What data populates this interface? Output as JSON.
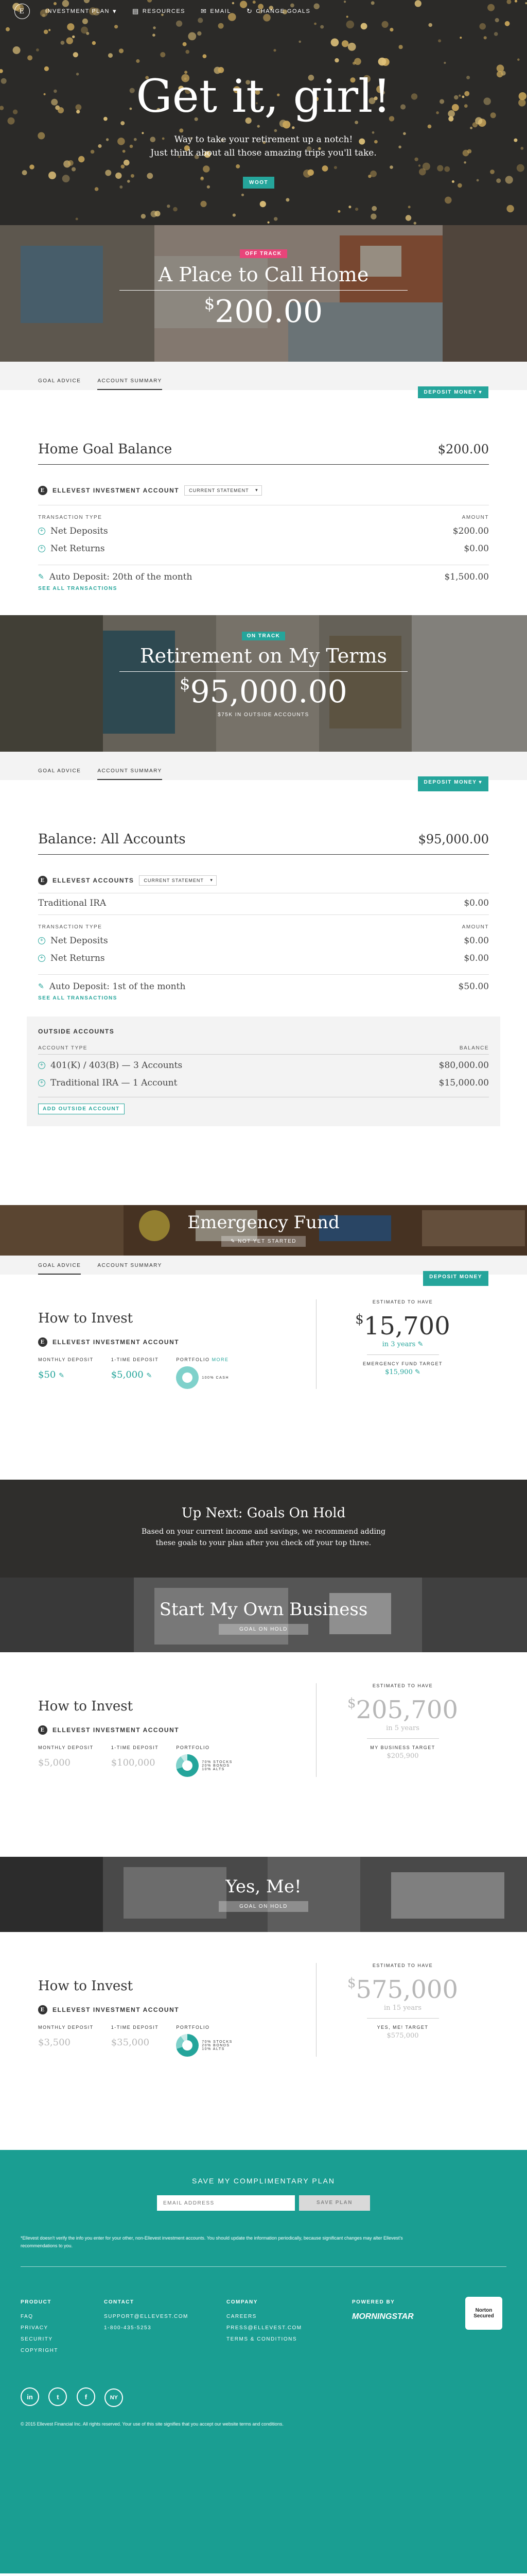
{
  "nav": {
    "logo": "E",
    "items": [
      "INVESTMENT PLAN",
      "RESOURCES",
      "EMAIL",
      "CHANGE GOALS"
    ],
    "item_icons": [
      "chevron-down-icon",
      "book-icon",
      "envelope-icon",
      "refresh-icon"
    ]
  },
  "hero": {
    "title": "Get it, girl!",
    "subtitle_1": "Way to take your retirement up a notch!",
    "subtitle_2": "Just think about all those amazing trips you'll take.",
    "button": "WOOT"
  },
  "home": {
    "badge": "OFF TRACK",
    "title": "A Place to Call Home",
    "amount_symbol": "$",
    "amount": "200.00",
    "tabs": [
      "GOAL ADVICE",
      "ACCOUNT SUMMARY"
    ],
    "deposit_button": "DEPOSIT MONEY",
    "balance_label": "Home Goal Balance",
    "balance_value": "$200.00",
    "account_name": "ELLEVEST INVESTMENT ACCOUNT",
    "statement": "CURRENT STATEMENT",
    "th_left": "TRANSACTION TYPE",
    "th_right": "AMOUNT",
    "rows": [
      {
        "label": "Net Deposits",
        "value": "$200.00"
      },
      {
        "label": "Net Returns",
        "value": "$0.00"
      }
    ],
    "auto_deposit": "Auto Deposit: 20th of the month",
    "auto_value": "$1,500.00",
    "see_all": "SEE ALL TRANSACTIONS"
  },
  "retire": {
    "badge": "ON TRACK",
    "title": "Retirement on My Terms",
    "amount_symbol": "$",
    "amount": "95,000.00",
    "note": "$75K IN OUTSIDE ACCOUNTS",
    "tabs": [
      "GOAL ADVICE",
      "ACCOUNT SUMMARY"
    ],
    "deposit_button": "DEPOSIT MONEY",
    "balance_label": "Balance: All Accounts",
    "balance_value": "$95,000.00",
    "account_name": "ELLEVEST ACCOUNTS",
    "statement": "CURRENT STATEMENT",
    "ira_label": "Traditional IRA",
    "ira_value": "$0.00",
    "th_left": "TRANSACTION TYPE",
    "th_right": "AMOUNT",
    "rows": [
      {
        "label": "Net Deposits",
        "value": "$0.00"
      },
      {
        "label": "Net Returns",
        "value": "$0.00"
      }
    ],
    "auto_deposit": "Auto Deposit: 1st of the month",
    "auto_value": "$50.00",
    "see_all": "SEE ALL TRANSACTIONS",
    "outside_title": "OUTSIDE ACCOUNTS",
    "outside_th_left": "ACCOUNT TYPE",
    "outside_th_right": "BALANCE",
    "outside_rows": [
      {
        "label": "401(K) / 403(B) — 3 Accounts",
        "value": "$80,000.00"
      },
      {
        "label": "Traditional IRA — 1 Account",
        "value": "$15,000.00"
      }
    ],
    "add_outside": "ADD OUTSIDE ACCOUNT"
  },
  "emergency": {
    "title": "Emergency Fund",
    "button": "NOT YET STARTED",
    "tabs": [
      "GOAL ADVICE",
      "ACCOUNT SUMMARY"
    ],
    "deposit_button": "DEPOSIT MONEY",
    "how": "How to Invest",
    "account_name": "ELLEVEST INVESTMENT ACCOUNT",
    "monthly_label": "MONTHLY DEPOSIT",
    "monthly_value": "$50",
    "onetime_label": "1-TIME DEPOSIT",
    "onetime_value": "$5,000",
    "portfolio_label": "PORTFOLIO",
    "portfolio_more": "MORE",
    "portfolio_note": "100% CASH",
    "est_label": "ESTIMATED TO HAVE",
    "est_symbol": "$",
    "est_value": "15,700",
    "est_years": "in 3 years",
    "target_label": "EMERGENCY FUND TARGET",
    "target_value": "$15,900"
  },
  "upnext": {
    "title": "Up Next: Goals On Hold",
    "text_1": "Based on your current income and savings, we recommend adding",
    "text_2": "these goals to your plan after you check off your top three."
  },
  "business": {
    "title": "Start My Own Business",
    "button": "GOAL ON HOLD",
    "how": "How to Invest",
    "account_name": "ELLEVEST INVESTMENT ACCOUNT",
    "monthly_label": "MONTHLY DEPOSIT",
    "monthly_value": "$5,000",
    "onetime_label": "1-TIME DEPOSIT",
    "onetime_value": "$100,000",
    "portfolio_label": "PORTFOLIO",
    "portfolio_note": "70% STOCKS 20% BONDS 10% ALTS",
    "est_label": "ESTIMATED TO HAVE",
    "est_symbol": "$",
    "est_value": "205,700",
    "est_years": "in 5 years",
    "target_label": "MY BUSINESS TARGET",
    "target_value": "$205,900"
  },
  "yesme": {
    "title": "Yes, Me!",
    "button": "GOAL ON HOLD",
    "how": "How to Invest",
    "account_name": "ELLEVEST INVESTMENT ACCOUNT",
    "monthly_label": "MONTHLY DEPOSIT",
    "monthly_value": "$3,500",
    "onetime_label": "1-TIME DEPOSIT",
    "onetime_value": "$35,000",
    "portfolio_label": "PORTFOLIO",
    "portfolio_note": "70% STOCKS 20% BONDS 10% ALTS",
    "est_label": "ESTIMATED TO HAVE",
    "est_symbol": "$",
    "est_value": "575,000",
    "est_years": "in 15 years",
    "target_label": "YES, ME! TARGET",
    "target_value": "$575,000"
  },
  "footer": {
    "save_title": "SAVE MY COMPLIMENTARY PLAN",
    "email_placeholder": "EMAIL ADDRESS",
    "save_button": "SAVE PLAN",
    "disclaimer": "*Ellevest doesn't verify the info you enter for your other, non-Ellevest investment accounts. You should update the information periodically, because significant changes may alter Ellevest's recommendations to you.",
    "col1_title": "PRODUCT",
    "col1": [
      "FAQ",
      "PRIVACY",
      "SECURITY",
      "COPYRIGHT"
    ],
    "col2_title": "CONTACT",
    "col2": [
      "SUPPORT@ELLEVEST.COM",
      "1-800-435-5253"
    ],
    "col3_title": "COMPANY",
    "col3": [
      "CAREERS",
      "PRESS@ELLEVEST.COM",
      "TERMS & CONDITIONS"
    ],
    "powered_by": "POWERED BY",
    "morningstar": "MORNINGSTAR",
    "norton": "Norton Secured",
    "social": [
      "in",
      "t",
      "f",
      "NY"
    ],
    "copyright": "© 2015 Ellevest Financial Inc. All rights reserved. Your use of this site signifies that you accept our website terms and conditions."
  }
}
